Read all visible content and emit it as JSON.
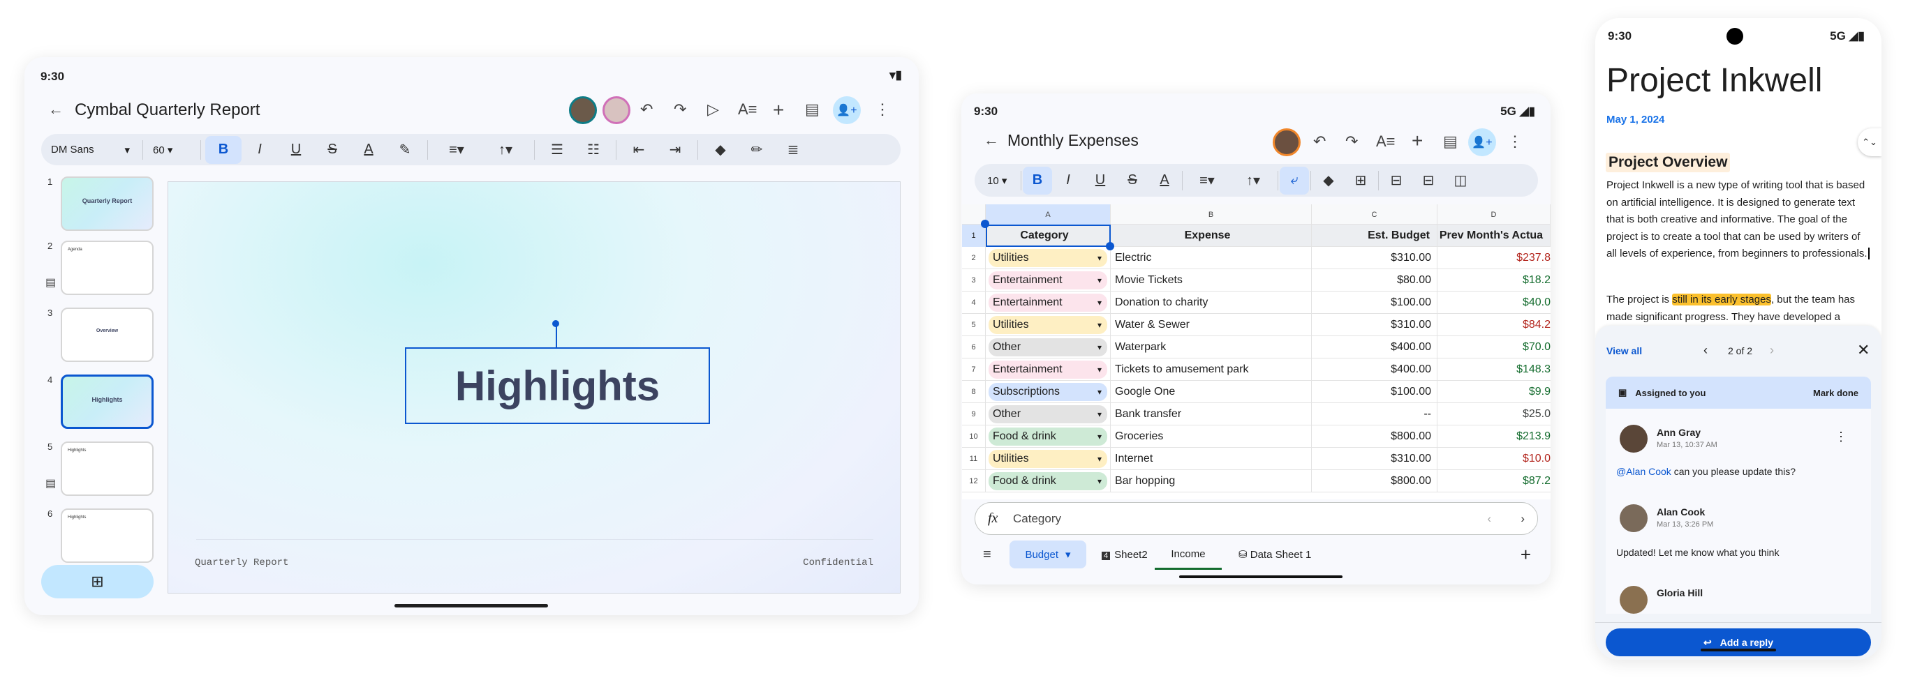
{
  "slides_app": {
    "status_time": "9:30",
    "title": "Cymbal Quarterly Report",
    "toolbar": {
      "font": "DM Sans",
      "size": "60"
    },
    "thumbnails": [
      {
        "num": "1",
        "title": "Quarterly Report",
        "has_comment": false
      },
      {
        "num": "2",
        "title": "Agenda",
        "has_comment": true
      },
      {
        "num": "3",
        "title": "Overview",
        "has_comment": false
      },
      {
        "num": "4",
        "title": "Highlights",
        "has_comment": false
      },
      {
        "num": "5",
        "title": "Highlights",
        "has_comment": true
      },
      {
        "num": "6",
        "title": "Highlights",
        "has_comment": false
      }
    ],
    "selected_slide": 4,
    "slide": {
      "title": "Highlights",
      "footer_left": "Quarterly Report",
      "footer_right": "Confidential"
    }
  },
  "sheets_app": {
    "status_time": "9:30",
    "status_network": "5G",
    "title": "Monthly Expenses",
    "toolbar": {
      "font_size": "10"
    },
    "columns": [
      "A",
      "B",
      "C",
      "D"
    ],
    "header": [
      "Category",
      "Expense",
      "Est. Budget",
      "Prev Month's Actua"
    ],
    "rows": [
      {
        "n": "2",
        "cat": "Utilities",
        "exp": "Electric",
        "budget": "$310.00",
        "prev": "$237.8",
        "tone": "red"
      },
      {
        "n": "3",
        "cat": "Entertainment",
        "exp": "Movie Tickets",
        "budget": "$80.00",
        "prev": "$18.2",
        "tone": "green"
      },
      {
        "n": "4",
        "cat": "Entertainment",
        "exp": "Donation to charity",
        "budget": "$100.00",
        "prev": "$40.0",
        "tone": "green"
      },
      {
        "n": "5",
        "cat": "Utilities",
        "exp": "Water & Sewer",
        "budget": "$310.00",
        "prev": "$84.2",
        "tone": "red"
      },
      {
        "n": "6",
        "cat": "Other",
        "exp": "Waterpark",
        "budget": "$400.00",
        "prev": "$70.0",
        "tone": "green"
      },
      {
        "n": "7",
        "cat": "Entertainment",
        "exp": "Tickets to amusement park",
        "budget": "$400.00",
        "prev": "$148.3",
        "tone": "green"
      },
      {
        "n": "8",
        "cat": "Subscriptions",
        "exp": "Google One",
        "budget": "$100.00",
        "prev": "$9.9",
        "tone": "green"
      },
      {
        "n": "9",
        "cat": "Other",
        "exp": "Bank transfer",
        "budget": "--",
        "prev": "$25.0",
        "tone": "gray"
      },
      {
        "n": "10",
        "cat": "Food & drink",
        "exp": "Groceries",
        "budget": "$800.00",
        "prev": "$213.9",
        "tone": "green"
      },
      {
        "n": "11",
        "cat": "Utilities",
        "exp": "Internet",
        "budget": "$310.00",
        "prev": "$10.0",
        "tone": "red"
      },
      {
        "n": "12",
        "cat": "Food & drink",
        "exp": "Bar hopping",
        "budget": "$800.00",
        "prev": "$87.2",
        "tone": "green"
      }
    ],
    "chip_colors": {
      "Utilities": "#feefc3",
      "Entertainment": "#fce4ec",
      "Other": "#e3e3e3",
      "Subscriptions": "#d3e3fd",
      "Food & drink": "#ceead6"
    },
    "tone_colors": {
      "red": "#b3261e",
      "green": "#146c2e",
      "gray": "#444746"
    },
    "formula": "Category",
    "tabs": [
      {
        "label": "Budget",
        "active_dropdown": true
      },
      {
        "label": "Sheet2",
        "badge": "4"
      },
      {
        "label": "Income",
        "underlined": true
      },
      {
        "label": "Data Sheet 1"
      }
    ]
  },
  "docs_app": {
    "status_time": "9:30",
    "status_network": "5G",
    "title": "Project Inkwell",
    "date": "May 1, 2024",
    "heading": "Project Overview",
    "para1": "Project Inkwell is a new type of writing tool that is based on artificial intelligence. It is designed to generate text that is both creative and informative. The goal of the project is to create a tool that can be used by writers of all levels of experience, from beginners to professionals.",
    "para2_pre": "The project is ",
    "para2_highlight": "still in its early stages",
    "para2_post": ", but the team has made significant progress. They have developed a",
    "comments": {
      "view_all": "View all",
      "pager": "2 of 2",
      "assigned": "Assigned to you",
      "mark_done": "Mark done",
      "thread": [
        {
          "name": "Ann Gray",
          "time": "Mar 13, 10:37 AM",
          "mention": "@Alan Cook",
          "text": " can you please update this?"
        },
        {
          "name": "Alan Cook",
          "time": "Mar 13, 3:26 PM",
          "text": "Updated! Let me know what you think"
        },
        {
          "name": "Gloria Hill"
        }
      ],
      "reply": "Add a reply"
    }
  }
}
